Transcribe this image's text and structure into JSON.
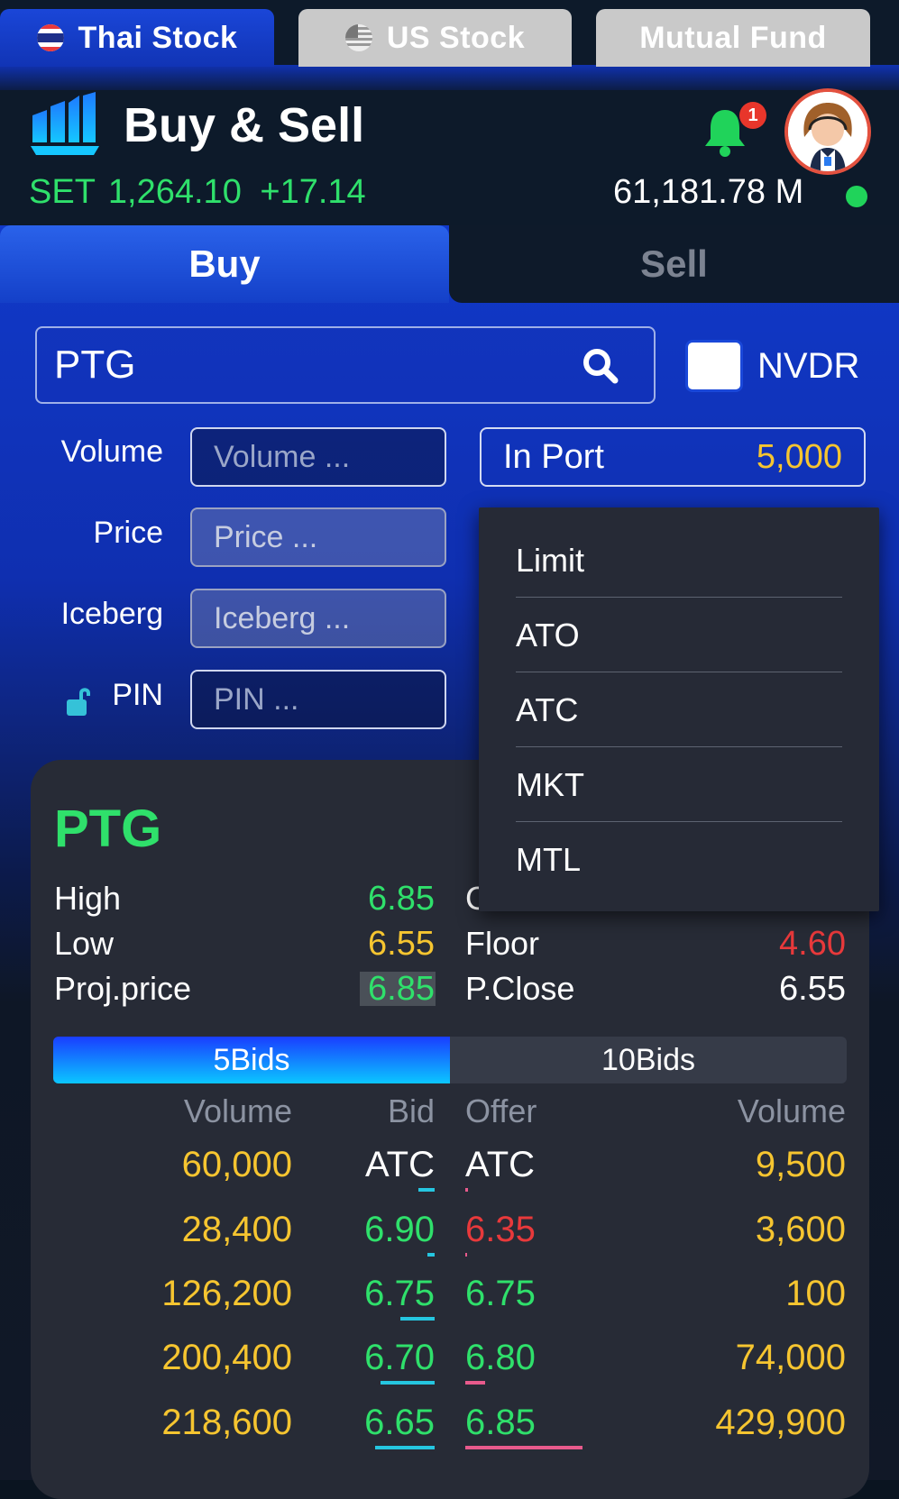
{
  "top_tabs": [
    {
      "label": "Thai Stock",
      "icon": "thailand-flag-icon",
      "active": true
    },
    {
      "label": "US Stock",
      "icon": "us-flag-icon",
      "active": false
    },
    {
      "label": "Mutual Fund",
      "active": false
    }
  ],
  "header": {
    "title": "Buy & Sell",
    "index_label": "SET",
    "index_value": "1,264.10",
    "index_change": "+17.14",
    "notification_count": "1",
    "balance": "61,181.78 M"
  },
  "order_tabs": {
    "buy": "Buy",
    "sell": "Sell"
  },
  "form": {
    "symbol": "PTG",
    "nvdr_label": "NVDR",
    "volume_label": "Volume",
    "volume_placeholder": "Volume ...",
    "price_label": "Price",
    "price_placeholder": "Price ...",
    "iceberg_label": "Iceberg",
    "iceberg_placeholder": "Iceberg ...",
    "pin_label": "PIN",
    "pin_placeholder": "PIN ...",
    "in_port_label": "In Port",
    "in_port_value": "5,000"
  },
  "price_type_dropdown": [
    "Limit",
    "ATO",
    "ATC",
    "MKT",
    "MTL"
  ],
  "quote": {
    "symbol": "PTG",
    "high_label": "High",
    "high": "6.85",
    "low_label": "Low",
    "low": "6.55",
    "proj_label": "Proj.price",
    "proj": "6.85",
    "floor_label": "Floor",
    "floor": "4.60",
    "pclose_label": "P.Close",
    "pclose": "6.55"
  },
  "depth_tabs": {
    "five": "5Bids",
    "ten": "10Bids"
  },
  "depth_headers": {
    "bid_volume": "Volume",
    "bid": "Bid",
    "offer": "Offer",
    "offer_volume": "Volume"
  },
  "depth_rows": [
    {
      "bid_vol": "60,000",
      "bid": "ATC",
      "offer": "ATC",
      "offer_vol": "9,500"
    },
    {
      "bid_vol": "28,400",
      "bid": "6.90",
      "offer": "6.35",
      "offer_vol": "3,600"
    },
    {
      "bid_vol": "126,200",
      "bid": "6.75",
      "offer": "6.75",
      "offer_vol": "100"
    },
    {
      "bid_vol": "200,400",
      "bid": "6.70",
      "offer": "6.80",
      "offer_vol": "74,000"
    },
    {
      "bid_vol": "218,600",
      "bid": "6.65",
      "offer": "6.85",
      "offer_vol": "429,900"
    }
  ],
  "colors": {
    "accent": "#1440c8",
    "up": "#2fe06b",
    "down": "#e8393b",
    "neutral": "#f6c530",
    "bid_bar": "#25c6e0",
    "offer_bar": "#e85a8c"
  }
}
